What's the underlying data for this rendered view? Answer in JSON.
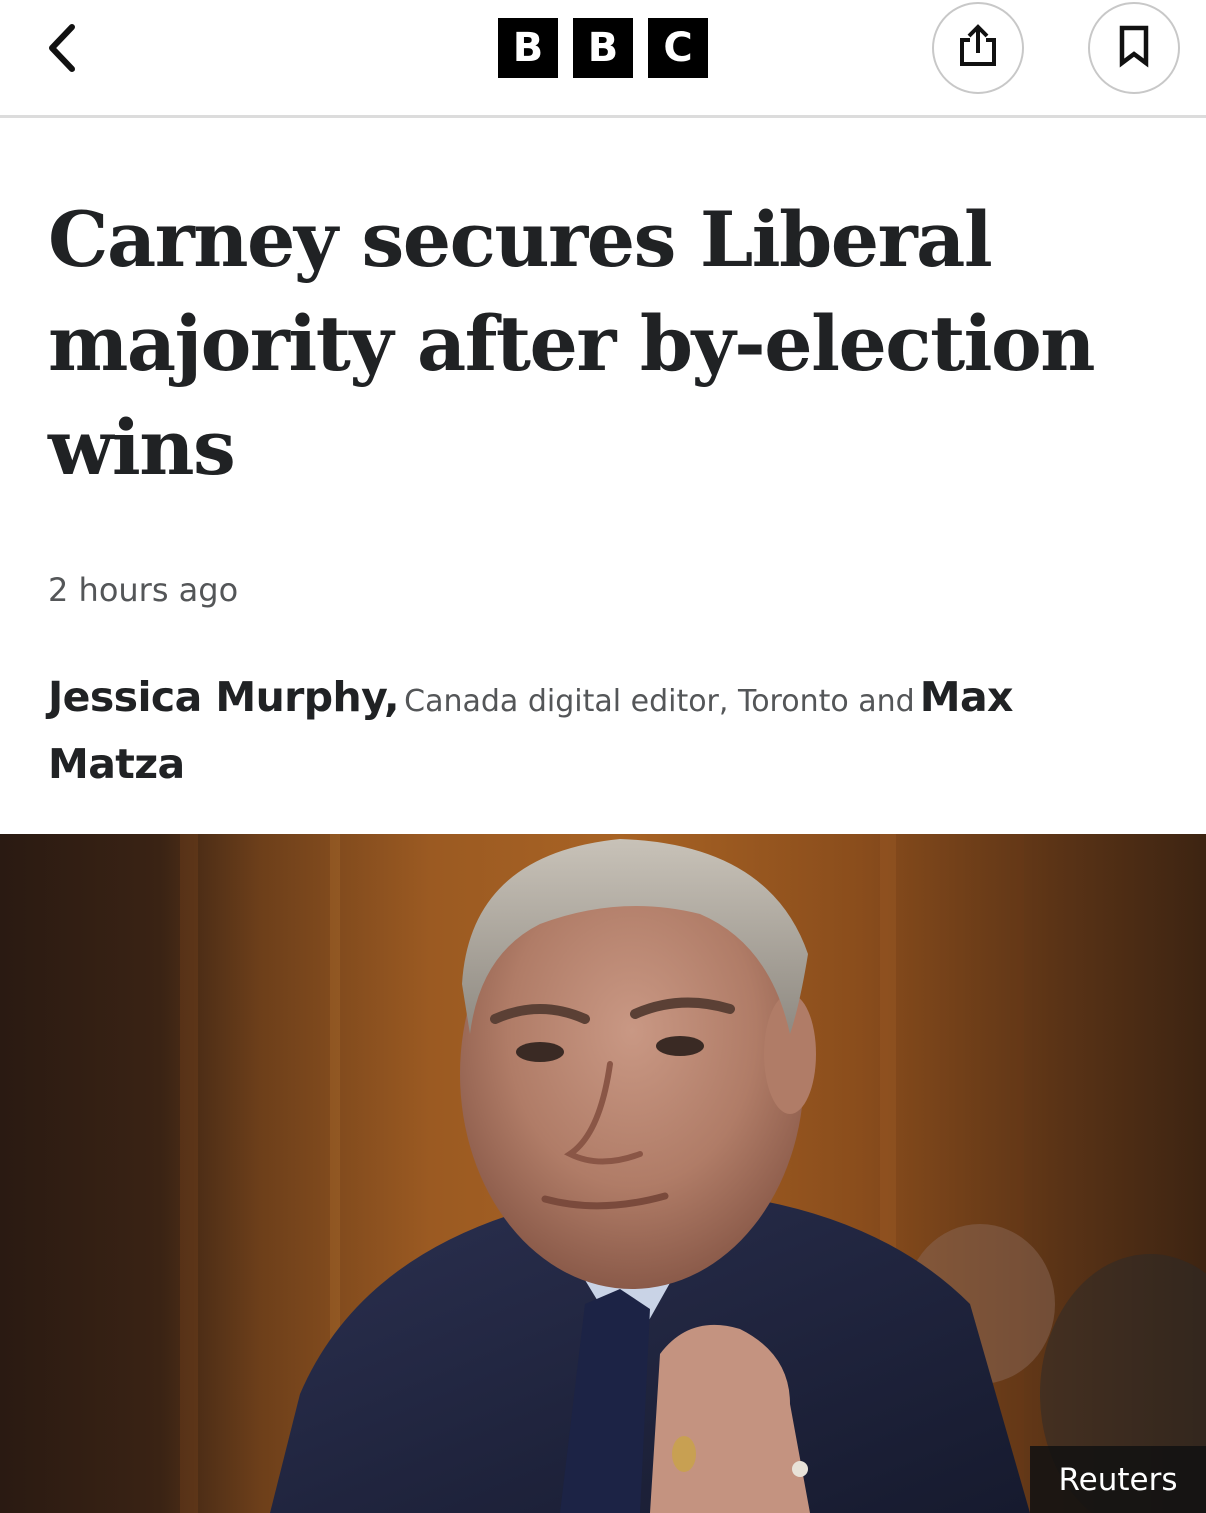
{
  "header": {
    "back_icon": "chevron-left-icon",
    "logo_letters": [
      "B",
      "B",
      "C"
    ],
    "share_icon": "share-icon",
    "bookmark_icon": "bookmark-icon"
  },
  "article": {
    "headline": "Carney secures Liberal majority after by-election wins",
    "timestamp": "2 hours ago",
    "byline": {
      "author1": "Jessica Murphy,",
      "author1_role": "Canada digital editor, Toronto and",
      "author2": "Max Matza"
    }
  },
  "hero": {
    "credit": "Reuters"
  },
  "colors": {
    "text": "#202224",
    "secondary_text": "#545658",
    "logo_background": "#000000",
    "divider": "#dcdcdc"
  }
}
